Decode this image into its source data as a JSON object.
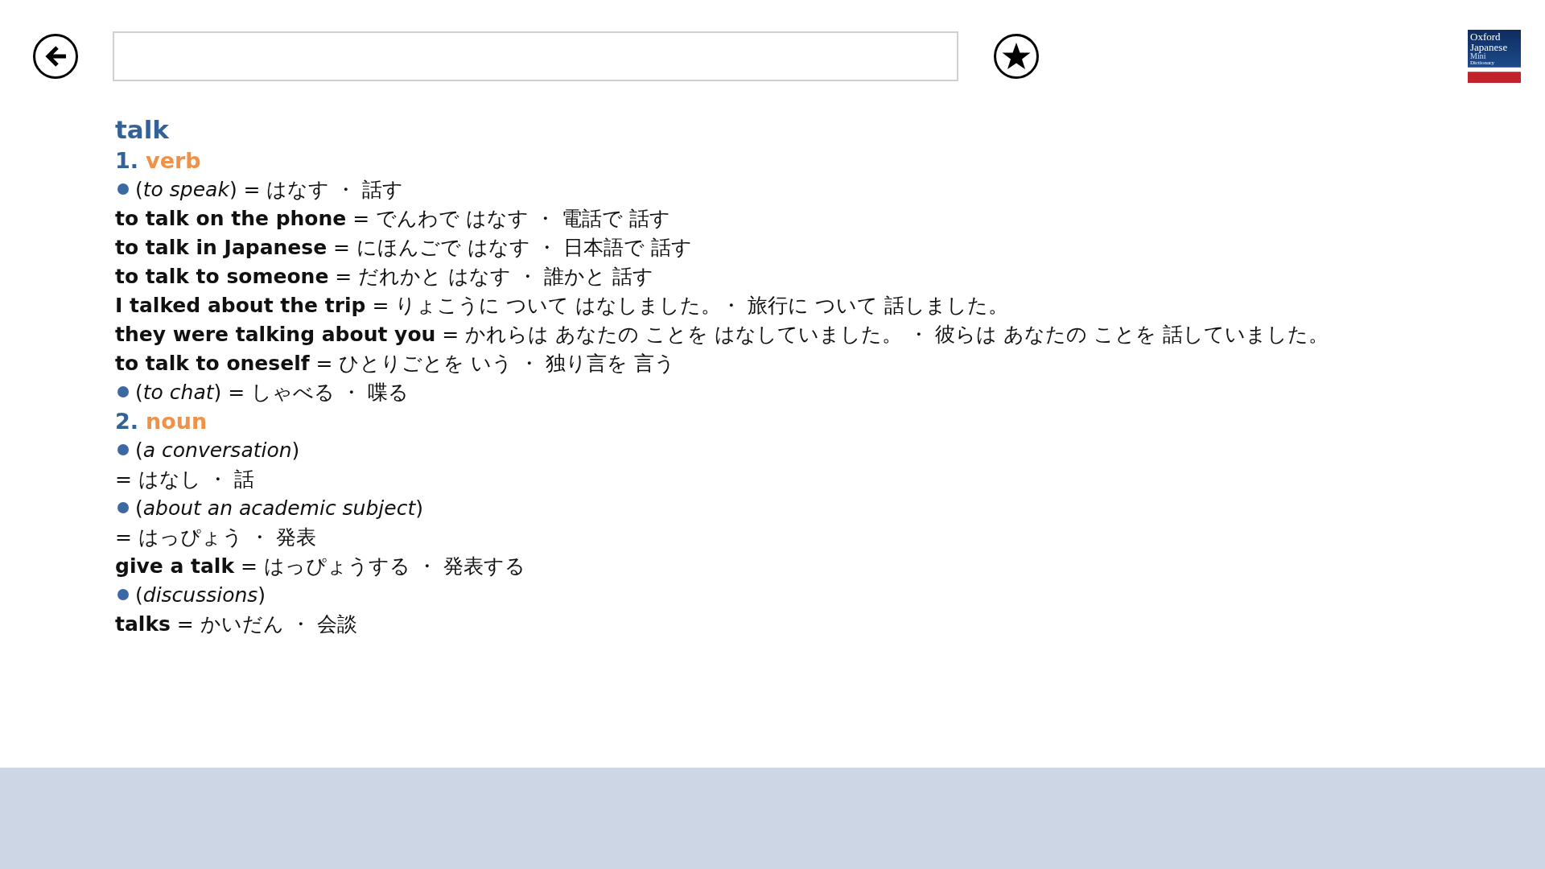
{
  "toolbar": {
    "logo": {
      "lines": [
        "Oxford",
        "Japanese",
        "Mini",
        "Dictionary"
      ]
    }
  },
  "entry": {
    "headword": "talk",
    "lines": [
      {
        "kind": "pos",
        "number": "1.",
        "label": "verb"
      },
      {
        "kind": "sense",
        "text": "(*to speak*) = はなす ・ 話す"
      },
      {
        "kind": "example",
        "text": "**to talk on the phone** = でんわで はなす ・ 電話で 話す"
      },
      {
        "kind": "example",
        "text": "**to talk in Japanese** = にほんごで はなす ・ 日本語で 話す"
      },
      {
        "kind": "example",
        "text": "**to talk to someone** = だれかと はなす ・ 誰かと 話す"
      },
      {
        "kind": "example",
        "text": "**I talked about the trip** = りょこうに ついて はなしました。・ 旅行に ついて 話しました。"
      },
      {
        "kind": "example",
        "text": "**they were talking about you** = かれらは あなたの ことを はなしていました。 ・ 彼らは あなたの ことを 話していました。"
      },
      {
        "kind": "example",
        "text": "**to talk to oneself** = ひとりごとを いう ・ 独り言を 言う"
      },
      {
        "kind": "sense",
        "text": "(*to chat*) = しゃべる ・ 喋る"
      },
      {
        "kind": "pos",
        "number": "2.",
        "label": "noun"
      },
      {
        "kind": "sense",
        "text": "(*a conversation*)"
      },
      {
        "kind": "example",
        "text": "= はなし ・ 話"
      },
      {
        "kind": "sense",
        "text": "(*about an academic subject*)"
      },
      {
        "kind": "example",
        "text": "= はっぴょう ・ 発表"
      },
      {
        "kind": "example",
        "text": "**give a talk** = はっぴょうする ・ 発表する"
      },
      {
        "kind": "sense",
        "text": "(*discussions*)"
      },
      {
        "kind": "example",
        "text": "**talks** = かいだん ・ 会談"
      }
    ]
  }
}
